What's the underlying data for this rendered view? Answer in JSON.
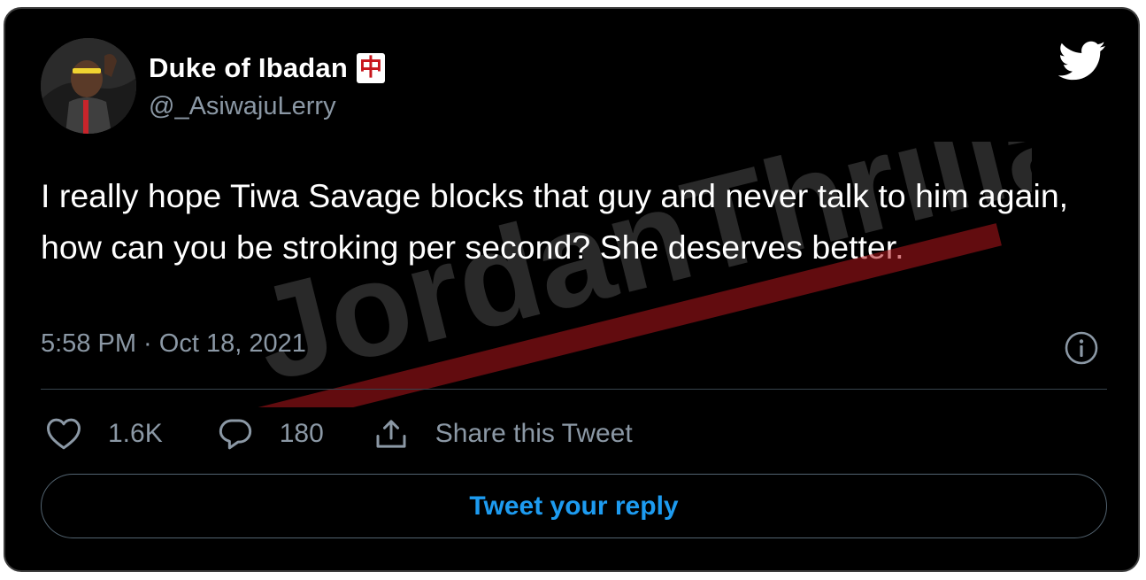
{
  "tweet": {
    "display_name": "Duke of Ibadan",
    "name_emoji": "中",
    "handle": "@_AsiwajuLerry",
    "text": "I really hope Tiwa Savage blocks that guy and never talk to him again, how can you be stroking per second? She deserves better.",
    "timestamp": "5:58 PM · Oct 18, 2021"
  },
  "actions": {
    "likes": "1.6K",
    "replies": "180",
    "share_label": "Share this Tweet"
  },
  "reply": {
    "button_label": "Tweet your reply"
  },
  "watermark": {
    "text": "JordanThrilla."
  },
  "colors": {
    "background": "#000000",
    "text": "#ffffff",
    "secondary_text": "#8b98a5",
    "accent": "#1d9bf0",
    "divider": "#38444d",
    "watermark_red": "#b3151b"
  },
  "icons": {
    "logo": "twitter-bird-icon",
    "info": "info-icon",
    "like": "heart-icon",
    "reply": "reply-bubble-icon",
    "share": "share-upload-icon"
  }
}
